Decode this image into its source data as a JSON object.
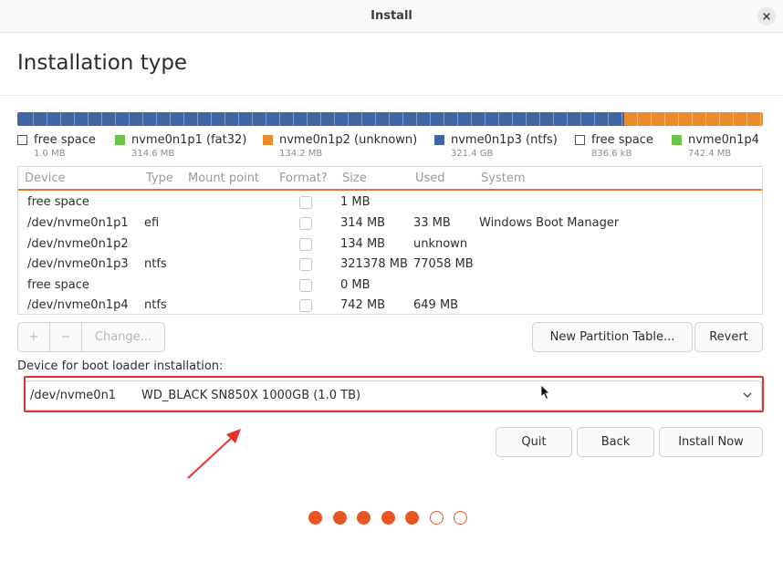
{
  "window": {
    "title": "Install"
  },
  "page": {
    "title": "Installation type"
  },
  "partition_bar": {
    "segments": [
      {
        "name": "free space",
        "color": "#3f65a3"
      },
      {
        "name": "nvme0n1p1",
        "color": "#6cc34a"
      },
      {
        "name": "nvme0n1p2",
        "color": "#ec8b2a"
      },
      {
        "name": "nvme0n1p3",
        "color": "#3f65a3"
      },
      {
        "name": "free space",
        "color": "#3f65a3"
      },
      {
        "name": "nvme0n1p4",
        "color": "#ec8b2a"
      }
    ]
  },
  "legend": [
    {
      "name": "free space",
      "size": "1.0 MB",
      "color": "#ffffff"
    },
    {
      "name": "nvme0n1p1 (fat32)",
      "size": "314.6 MB",
      "color": "#6cc34a"
    },
    {
      "name": "nvme0n1p2 (unknown)",
      "size": "134.2 MB",
      "color": "#ec8b2a"
    },
    {
      "name": "nvme0n1p3 (ntfs)",
      "size": "321.4 GB",
      "color": "#3f65a3"
    },
    {
      "name": "free space",
      "size": "836.6 kB",
      "color": "#ffffff"
    },
    {
      "name": "nvme0n1p4",
      "size": "742.4 MB",
      "color": "#6cc34a"
    }
  ],
  "table": {
    "headers": [
      "Device",
      "Type",
      "Mount point",
      "Format?",
      "Size",
      "Used",
      "System"
    ],
    "rows": [
      {
        "device": "free space",
        "type": "",
        "mount": "",
        "size": "1 MB",
        "used": "",
        "system": ""
      },
      {
        "device": "/dev/nvme0n1p1",
        "type": "efi",
        "mount": "",
        "size": "314 MB",
        "used": "33 MB",
        "system": "Windows Boot Manager"
      },
      {
        "device": "/dev/nvme0n1p2",
        "type": "",
        "mount": "",
        "size": "134 MB",
        "used": "unknown",
        "system": ""
      },
      {
        "device": "/dev/nvme0n1p3",
        "type": "ntfs",
        "mount": "",
        "size": "321378 MB",
        "used": "77058 MB",
        "system": ""
      },
      {
        "device": "free space",
        "type": "",
        "mount": "",
        "size": "0 MB",
        "used": "",
        "system": ""
      },
      {
        "device": "/dev/nvme0n1p4",
        "type": "ntfs",
        "mount": "",
        "size": "742 MB",
        "used": "649 MB",
        "system": ""
      }
    ]
  },
  "toolbar": {
    "add_label": "+",
    "remove_label": "−",
    "change_label": "Change...",
    "new_table_label": "New Partition Table...",
    "revert_label": "Revert"
  },
  "boot_loader": {
    "label": "Device for boot loader installation:",
    "device": "/dev/nvme0n1",
    "model": "WD_BLACK SN850X 1000GB (1.0 TB)"
  },
  "actions": {
    "quit_label": "Quit",
    "back_label": "Back",
    "install_label": "Install Now"
  },
  "progress": {
    "total_steps": 7,
    "completed_steps": 5
  },
  "colors": {
    "accent": "#e95420",
    "annotation": "#e63030",
    "table_header_rule": "#e5762e"
  }
}
